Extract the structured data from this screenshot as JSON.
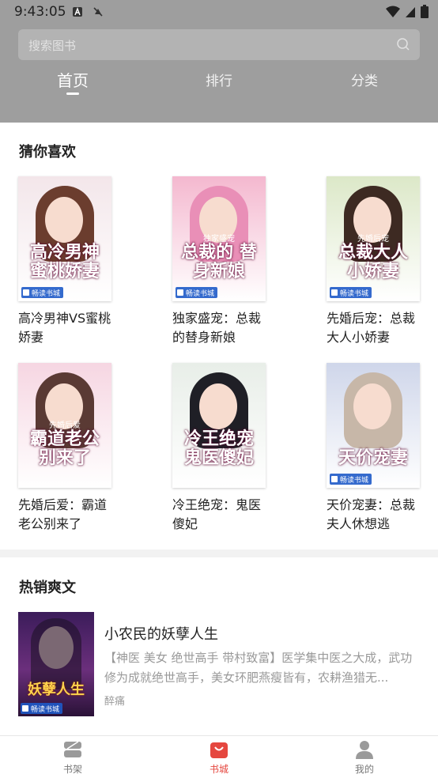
{
  "status_bar": {
    "time": "9:43:05"
  },
  "search": {
    "placeholder": "搜索图书"
  },
  "tabs": [
    {
      "label": "首页",
      "active": true
    },
    {
      "label": "排行",
      "active": false
    },
    {
      "label": "分类",
      "active": false
    }
  ],
  "guess_section": {
    "title": "猜你喜欢",
    "books": [
      {
        "name": "高冷男神VS蜜桃娇妻",
        "cover_text": "高冷男神 蜜桃娇妻",
        "cover_brand": "畅读书城",
        "cover_bg": "#f3e6ea",
        "hair": "#6b3d2e"
      },
      {
        "name": "独家盛宠：总裁的替身新娘",
        "cover_text": "总裁的 替身新娘",
        "cover_sub": "独家盛宠",
        "cover_brand": "畅读书城",
        "cover_bg": "#f4b8cf",
        "hair": "#e98fb7"
      },
      {
        "name": "先婚后宠：总裁大人小娇妻",
        "cover_text": "总裁大人 小娇妻",
        "cover_sub": "先婚后宠",
        "cover_brand": "畅读书城",
        "cover_bg": "#dce8c8",
        "hair": "#3d2a22"
      },
      {
        "name": "先婚后爱：霸道老公别来了",
        "cover_text": "霸道老公 别来了",
        "cover_sub": "先婚后爱",
        "cover_brand": "",
        "cover_bg": "#f6d6e2",
        "hair": "#5a3a34"
      },
      {
        "name": "冷王绝宠：鬼医傻妃",
        "cover_text": "冷王绝宠 鬼医傻妃",
        "cover_brand": "",
        "cover_bg": "#e8eee8",
        "hair": "#1f1f26"
      },
      {
        "name": "天价宠妻：总裁夫人休想逃",
        "cover_text": "天价宠妻",
        "cover_brand": "畅读书城",
        "cover_bg": "#cfd6ea",
        "hair": "#c7b7a8"
      }
    ]
  },
  "hot_section": {
    "title": "热销爽文",
    "book": {
      "title": "小农民的妖孽人生",
      "description": "【神医 美女 绝世高手 带村致富】医学集中医之大成，武功修为成就绝世高手，美女环肥燕瘦皆有，农耕渔猎无...",
      "author": "醉痛",
      "cover_text": "妖孽人生",
      "cover_brand": "畅读书城"
    }
  },
  "bottom_nav": [
    {
      "label": "书架",
      "icon": "bookshelf-icon",
      "active": false
    },
    {
      "label": "书城",
      "icon": "bookstore-icon",
      "active": true
    },
    {
      "label": "我的",
      "icon": "profile-icon",
      "active": false
    }
  ],
  "colors": {
    "header_bg": "#9e9e9e",
    "accent": "#e5473f"
  }
}
